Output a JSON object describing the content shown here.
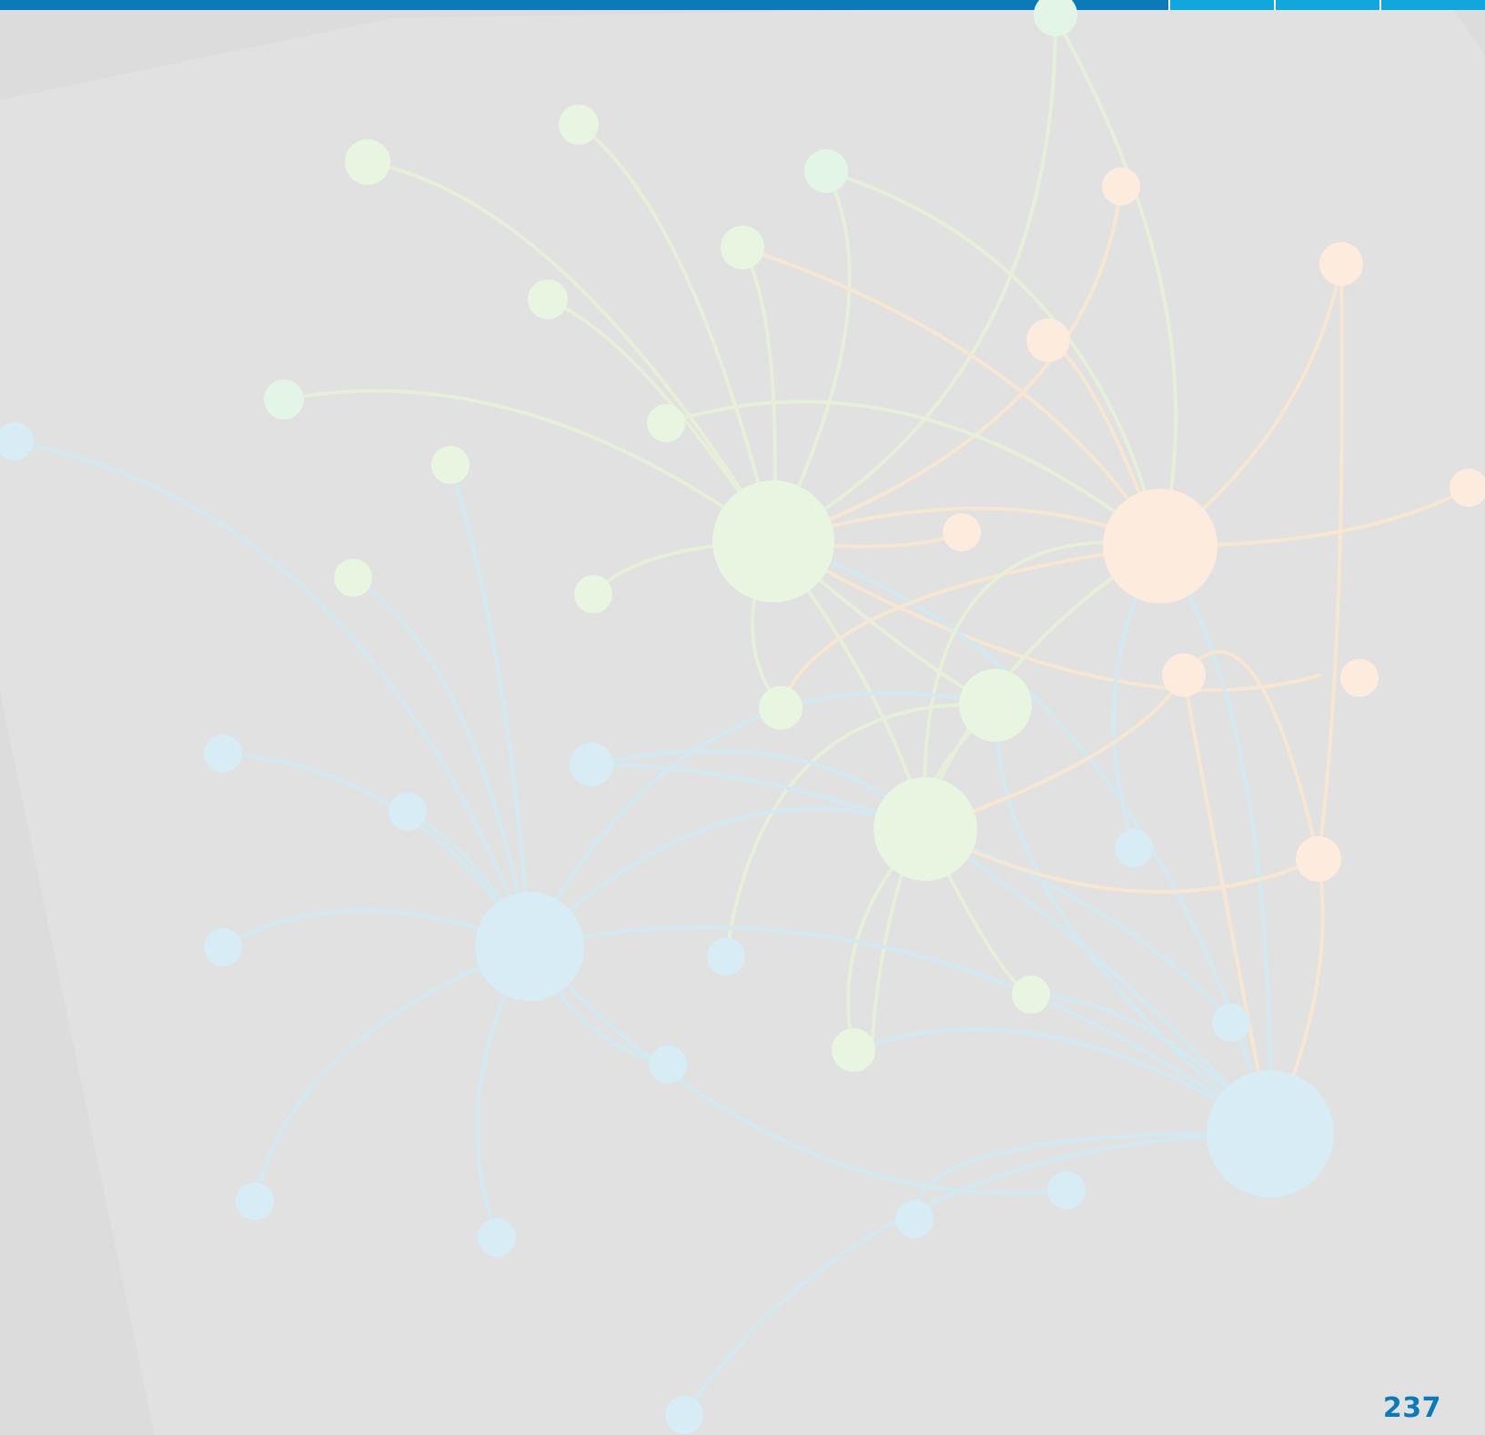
{
  "page": {
    "number": "237"
  },
  "colors": {
    "background": "#dcdcdc",
    "top_bar_main": "#0b7ab8",
    "top_bar_accent": "#10a7dc",
    "page_number": "#0b7ab8",
    "node_green": "#e8f5e1",
    "node_orange": "#fdebdd",
    "node_blue": "#d7ecf5",
    "edge_green": "#e6efd8",
    "edge_orange": "#f6e6d2",
    "edge_blue": "#d3e9f1"
  },
  "decoration": {
    "type": "network-graph-illustration",
    "node_groups": [
      "green",
      "orange",
      "blue"
    ]
  }
}
